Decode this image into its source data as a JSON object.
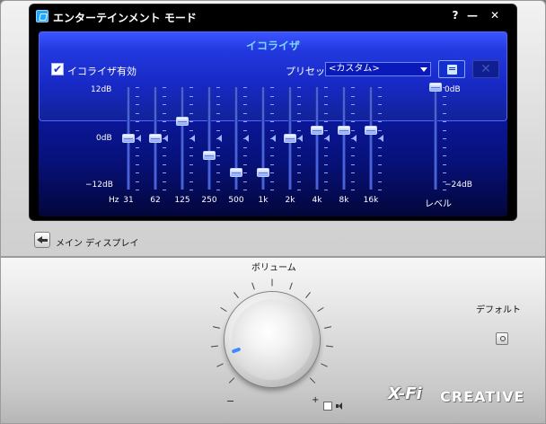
{
  "window": {
    "title": "エンターテインメント モード",
    "help_label": "?",
    "minimize_label": "—",
    "close_label": "✕",
    "icon": "app-icon"
  },
  "equalizer": {
    "title": "イコライザ",
    "enable_label": "イコライザ有効",
    "enabled": true,
    "preset_label": "プリセット",
    "preset_value": "<カスタム>",
    "save_icon": "save-preset-icon",
    "delete_icon": "delete-preset-icon",
    "delete_label": "✕",
    "scale": {
      "top": "12dB",
      "mid": "0dB",
      "bottom": "−12dB"
    },
    "hz_label": "Hz",
    "bands": [
      {
        "freq": "31",
        "value_db": 0
      },
      {
        "freq": "62",
        "value_db": 0
      },
      {
        "freq": "125",
        "value_db": 4
      },
      {
        "freq": "250",
        "value_db": -4
      },
      {
        "freq": "500",
        "value_db": -8
      },
      {
        "freq": "1k",
        "value_db": -8
      },
      {
        "freq": "2k",
        "value_db": 0
      },
      {
        "freq": "4k",
        "value_db": 2
      },
      {
        "freq": "8k",
        "value_db": 2
      },
      {
        "freq": "16k",
        "value_db": 2
      }
    ],
    "level": {
      "label": "レベル",
      "top": "0dB",
      "bottom": "−24dB",
      "value_db": 0
    }
  },
  "navigation": {
    "main_display_label": "メイン ディスプレイ",
    "back_icon": "arrow-left-icon"
  },
  "volume": {
    "label": "ボリューム",
    "minus": "−",
    "plus": "+",
    "mute_checked": false,
    "speaker_icon": "speaker-icon"
  },
  "default": {
    "label": "デフォルト"
  },
  "branding": {
    "xfi": "X-Fi",
    "creative": "CREATIVE"
  }
}
